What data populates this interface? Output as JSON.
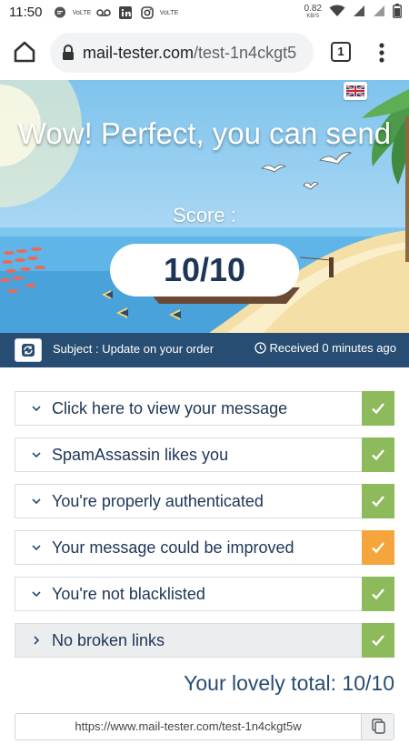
{
  "status_bar": {
    "time": "11:50",
    "network_speed_value": "0.82",
    "network_speed_unit": "KB/S",
    "icons": [
      "chat-bubble-icon",
      "volte-icon",
      "voicemail-icon",
      "linkedin-icon",
      "instagram-icon",
      "volte-icon",
      "wifi-icon",
      "signal-icon",
      "signal-icon",
      "battery-icon"
    ]
  },
  "browser": {
    "url_domain": "mail-tester.com",
    "url_path": "/test-1n4ckgt5",
    "tab_count": "1"
  },
  "hero": {
    "title": "Wow! Perfect, you can send",
    "score_label": "Score :",
    "score": "10/10",
    "language_icon": "uk-flag-icon"
  },
  "subject_bar": {
    "subject": "Subject : Update on your order",
    "received": "Received 0 minutes ago"
  },
  "checks": [
    {
      "label": "Click here to view your message",
      "status": "ok",
      "expanded": true
    },
    {
      "label": "SpamAssassin likes you",
      "status": "ok",
      "expanded": true
    },
    {
      "label": "You're properly authenticated",
      "status": "ok",
      "expanded": true
    },
    {
      "label": "Your message could be improved",
      "status": "warning",
      "expanded": true
    },
    {
      "label": "You're not blacklisted",
      "status": "ok",
      "expanded": true
    },
    {
      "label": "No broken links",
      "status": "ok",
      "expanded": false
    }
  ],
  "status_colors": {
    "ok": "#8dba5a",
    "warning": "#f4a63c"
  },
  "total": "Your lovely total: 10/10",
  "permalink": "https://www.mail-tester.com/test-1n4ckgt5w"
}
